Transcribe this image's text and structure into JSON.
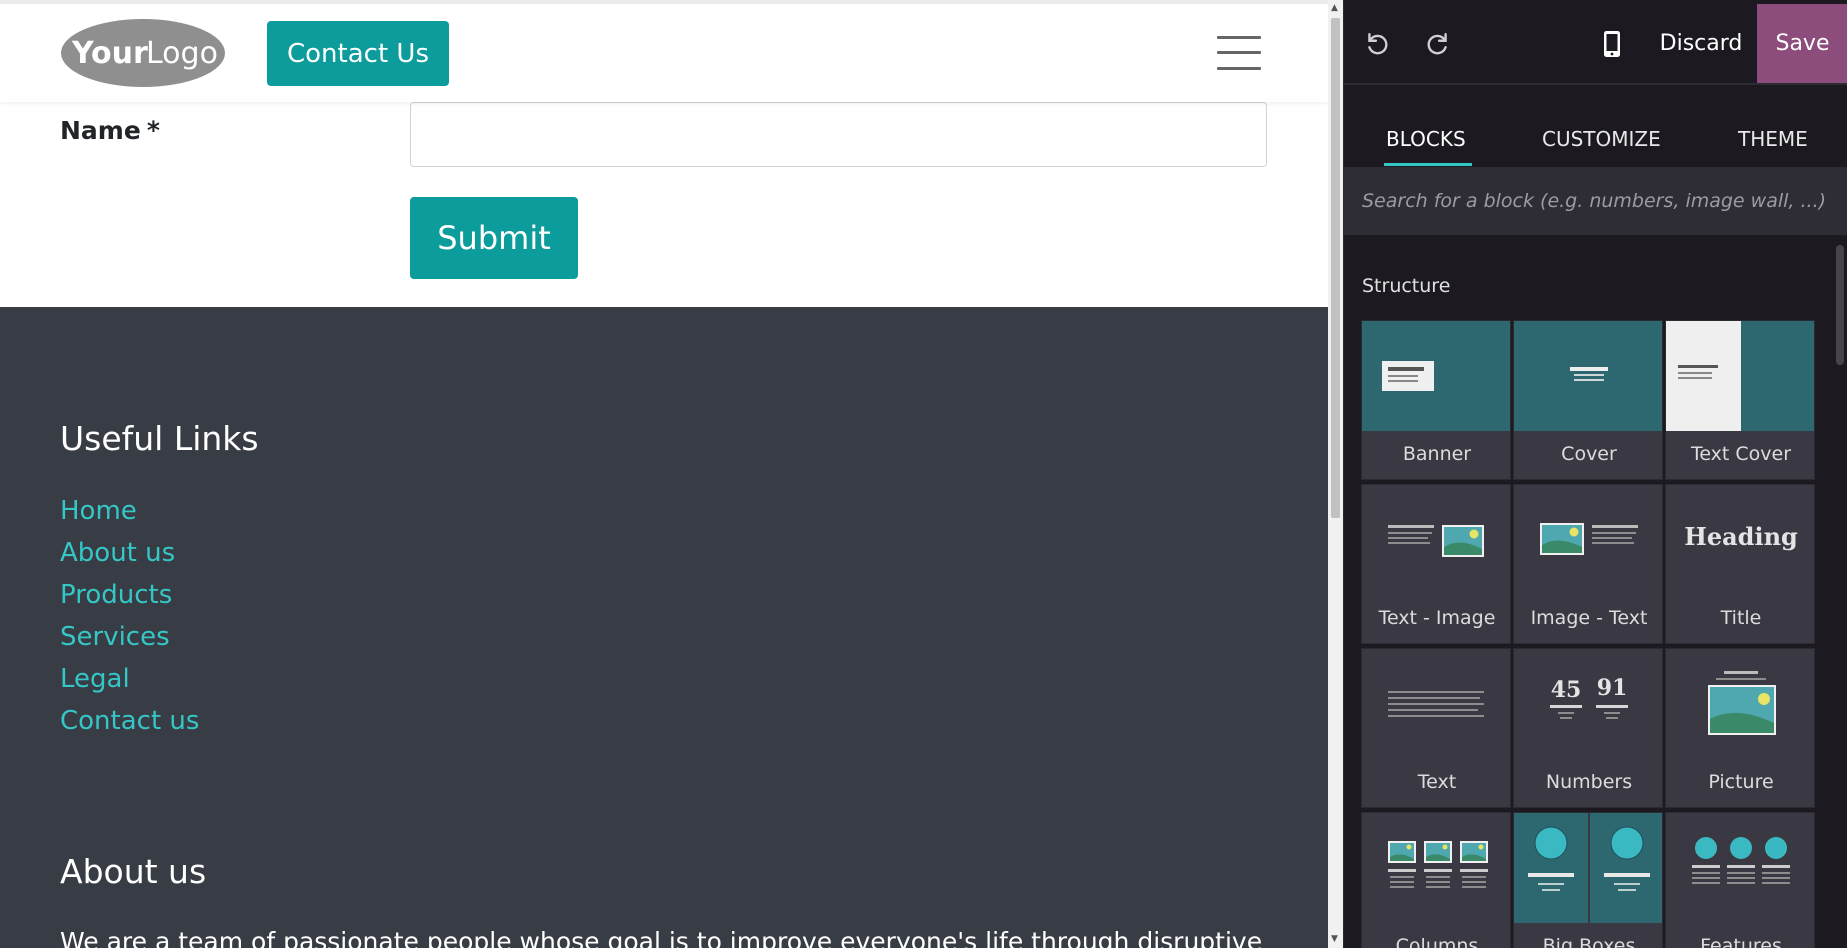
{
  "header": {
    "logo_text_bold": "Your",
    "logo_text_light": "Logo",
    "contact_button": "Contact Us",
    "menu_icon": "hamburger-icon"
  },
  "form": {
    "name_label": "Name",
    "required_mark": "*",
    "name_value": "",
    "submit_label": "Submit"
  },
  "footer": {
    "useful_links_title": "Useful Links",
    "links": [
      "Home",
      "About us",
      "Products",
      "Services",
      "Legal",
      "Contact us"
    ],
    "about_title": "About us",
    "about_text": "We are a team of passionate people whose goal is to improve everyone's life through disruptive"
  },
  "editor": {
    "undo_icon": "undo-icon",
    "redo_icon": "redo-icon",
    "mobile_icon": "mobile-preview-icon",
    "discard_label": "Discard",
    "save_label": "Save",
    "tabs": [
      "BLOCKS",
      "CUSTOMIZE",
      "THEME"
    ],
    "active_tab": "BLOCKS",
    "search_placeholder": "Search for a block (e.g. numbers, image wall, ...)",
    "section_title": "Structure",
    "blocks": [
      {
        "label": "Banner",
        "icon": "banner-thumbnail"
      },
      {
        "label": "Cover",
        "icon": "cover-thumbnail"
      },
      {
        "label": "Text Cover",
        "icon": "text-cover-thumbnail"
      },
      {
        "label": "Text - Image",
        "icon": "text-image-thumbnail"
      },
      {
        "label": "Image - Text",
        "icon": "image-text-thumbnail"
      },
      {
        "label": "Title",
        "icon": "title-thumbnail",
        "thumb_text": "Heading"
      },
      {
        "label": "Text",
        "icon": "text-thumbnail"
      },
      {
        "label": "Numbers",
        "icon": "numbers-thumbnail",
        "thumb_values": [
          "45",
          "91"
        ]
      },
      {
        "label": "Picture",
        "icon": "picture-thumbnail"
      },
      {
        "label": "Columns",
        "icon": "columns-thumbnail"
      },
      {
        "label": "Big Boxes",
        "icon": "big-boxes-thumbnail"
      },
      {
        "label": "Features",
        "icon": "features-thumbnail"
      }
    ]
  },
  "colors": {
    "accent": "#0c9c9c",
    "link": "#35c6c6",
    "footer_bg": "#383c45",
    "panel_bg": "#1c1a20",
    "save_bg": "#8c4c7c",
    "thumb_teal": "#2d6770"
  }
}
